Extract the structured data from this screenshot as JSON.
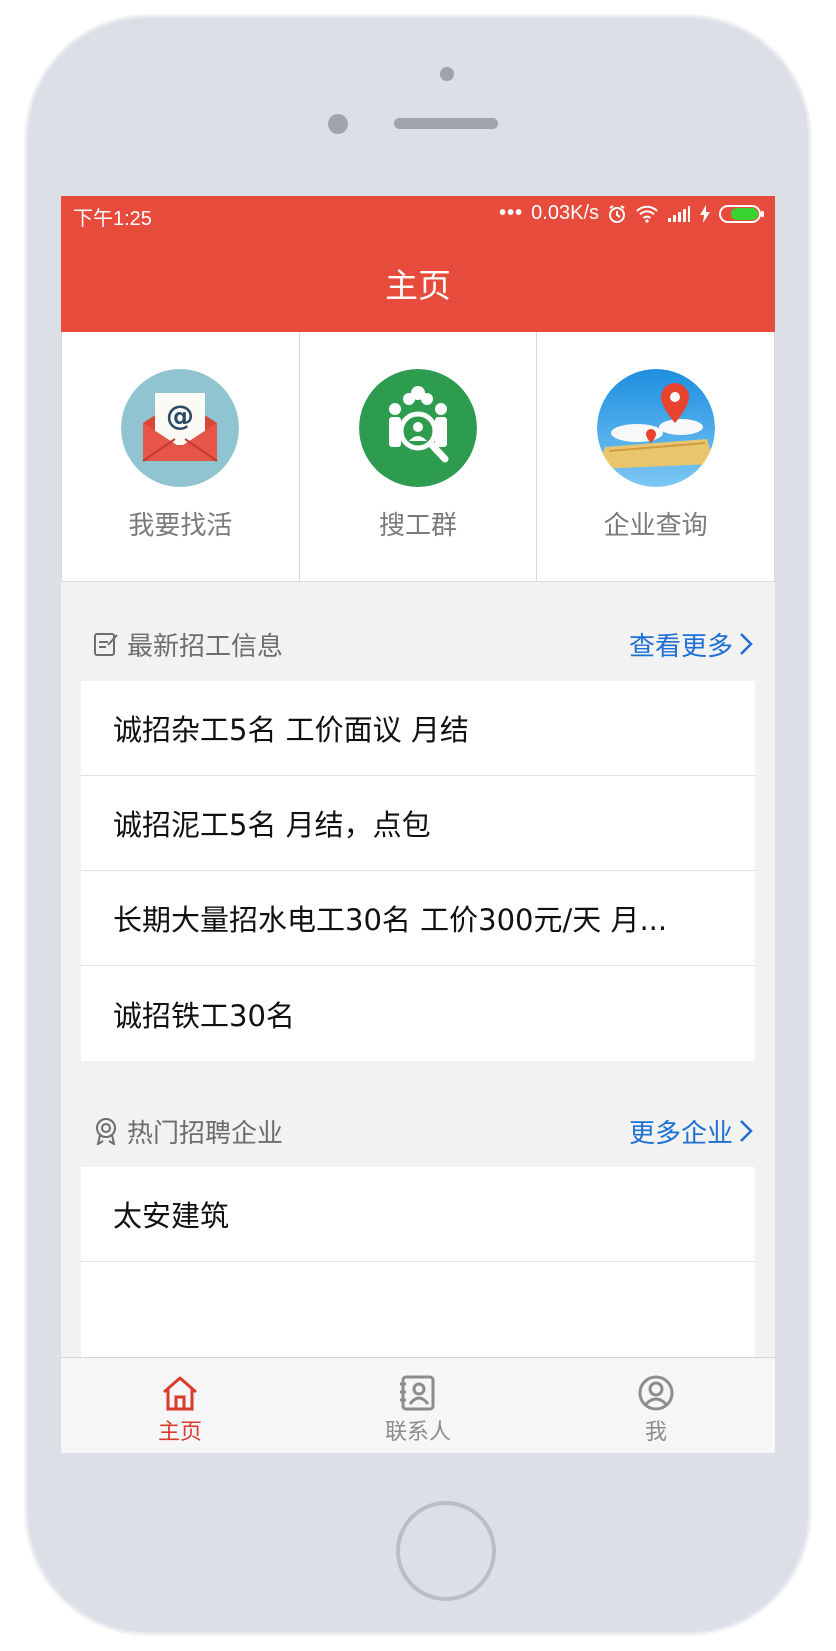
{
  "status_bar": {
    "time": "下午1:25",
    "network_speed": "0.03K/s",
    "icons": [
      "more-dots-icon",
      "alarm-icon",
      "wifi-icon",
      "signal-icon",
      "charging-icon",
      "battery-icon"
    ]
  },
  "header": {
    "title": "主页"
  },
  "quick_entries": [
    {
      "label": "我要找活",
      "icon": "envelope-at-icon"
    },
    {
      "label": "搜工群",
      "icon": "workers-search-icon"
    },
    {
      "label": "企业查询",
      "icon": "map-pin-icon"
    }
  ],
  "jobs_section": {
    "title": "最新招工信息",
    "more_label": "查看更多",
    "items": [
      "诚招杂工5名 工价面议 月结",
      "诚招泥工5名 月结，点包",
      "长期大量招水电工30名 工价300元/天 月...",
      "诚招铁工30名"
    ]
  },
  "companies_section": {
    "title": "热门招聘企业",
    "more_label": "更多企业",
    "items": [
      "太安建筑",
      ""
    ]
  },
  "tabbar": {
    "tabs": [
      {
        "label": "主页",
        "icon": "home-icon",
        "active": true
      },
      {
        "label": "联系人",
        "icon": "contacts-icon",
        "active": false
      },
      {
        "label": "我",
        "icon": "user-icon",
        "active": false
      }
    ]
  },
  "colors": {
    "accent": "#e64b3c",
    "link": "#1f6fd2",
    "tab_active": "#d93b2c"
  }
}
